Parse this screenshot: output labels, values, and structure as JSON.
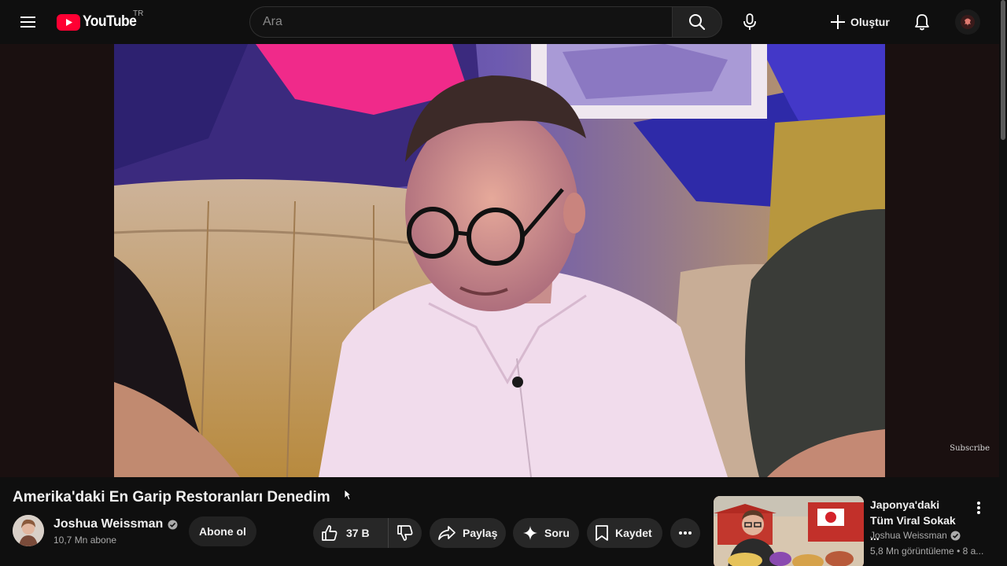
{
  "header": {
    "logo_text": "YouTube",
    "region": "TR",
    "search_placeholder": "Ara",
    "create_label": "Oluştur"
  },
  "player": {
    "watermark": "Subscribe"
  },
  "video": {
    "title": "Amerika'daki En Garip Restoranları Denedim"
  },
  "channel": {
    "name": "Joshua Weissman",
    "subscribers": "10,7 Mn abone",
    "subscribe_label": "Abone ol"
  },
  "actions": {
    "like_count": "37 B",
    "share_label": "Paylaş",
    "ask_label": "Soru",
    "save_label": "Kaydet"
  },
  "recommended": [
    {
      "title": "Japonya'daki Tüm Viral Sokak ...",
      "channel": "Joshua Weissman",
      "meta": "5,8 Mn görüntüleme • 8 a..."
    }
  ],
  "colors": {
    "background": "#0f0f0f",
    "logo_red": "#ff0033",
    "pill": "#272727",
    "secondary_text": "#aaaaaa"
  },
  "icons": [
    "menu-icon",
    "youtube-logo-icon",
    "search-icon",
    "microphone-icon",
    "plus-icon",
    "bell-icon",
    "verified-icon",
    "thumbs-up-icon",
    "thumbs-down-icon",
    "share-icon",
    "sparkle-icon",
    "bookmark-icon",
    "more-horizontal-icon",
    "more-vertical-icon"
  ]
}
